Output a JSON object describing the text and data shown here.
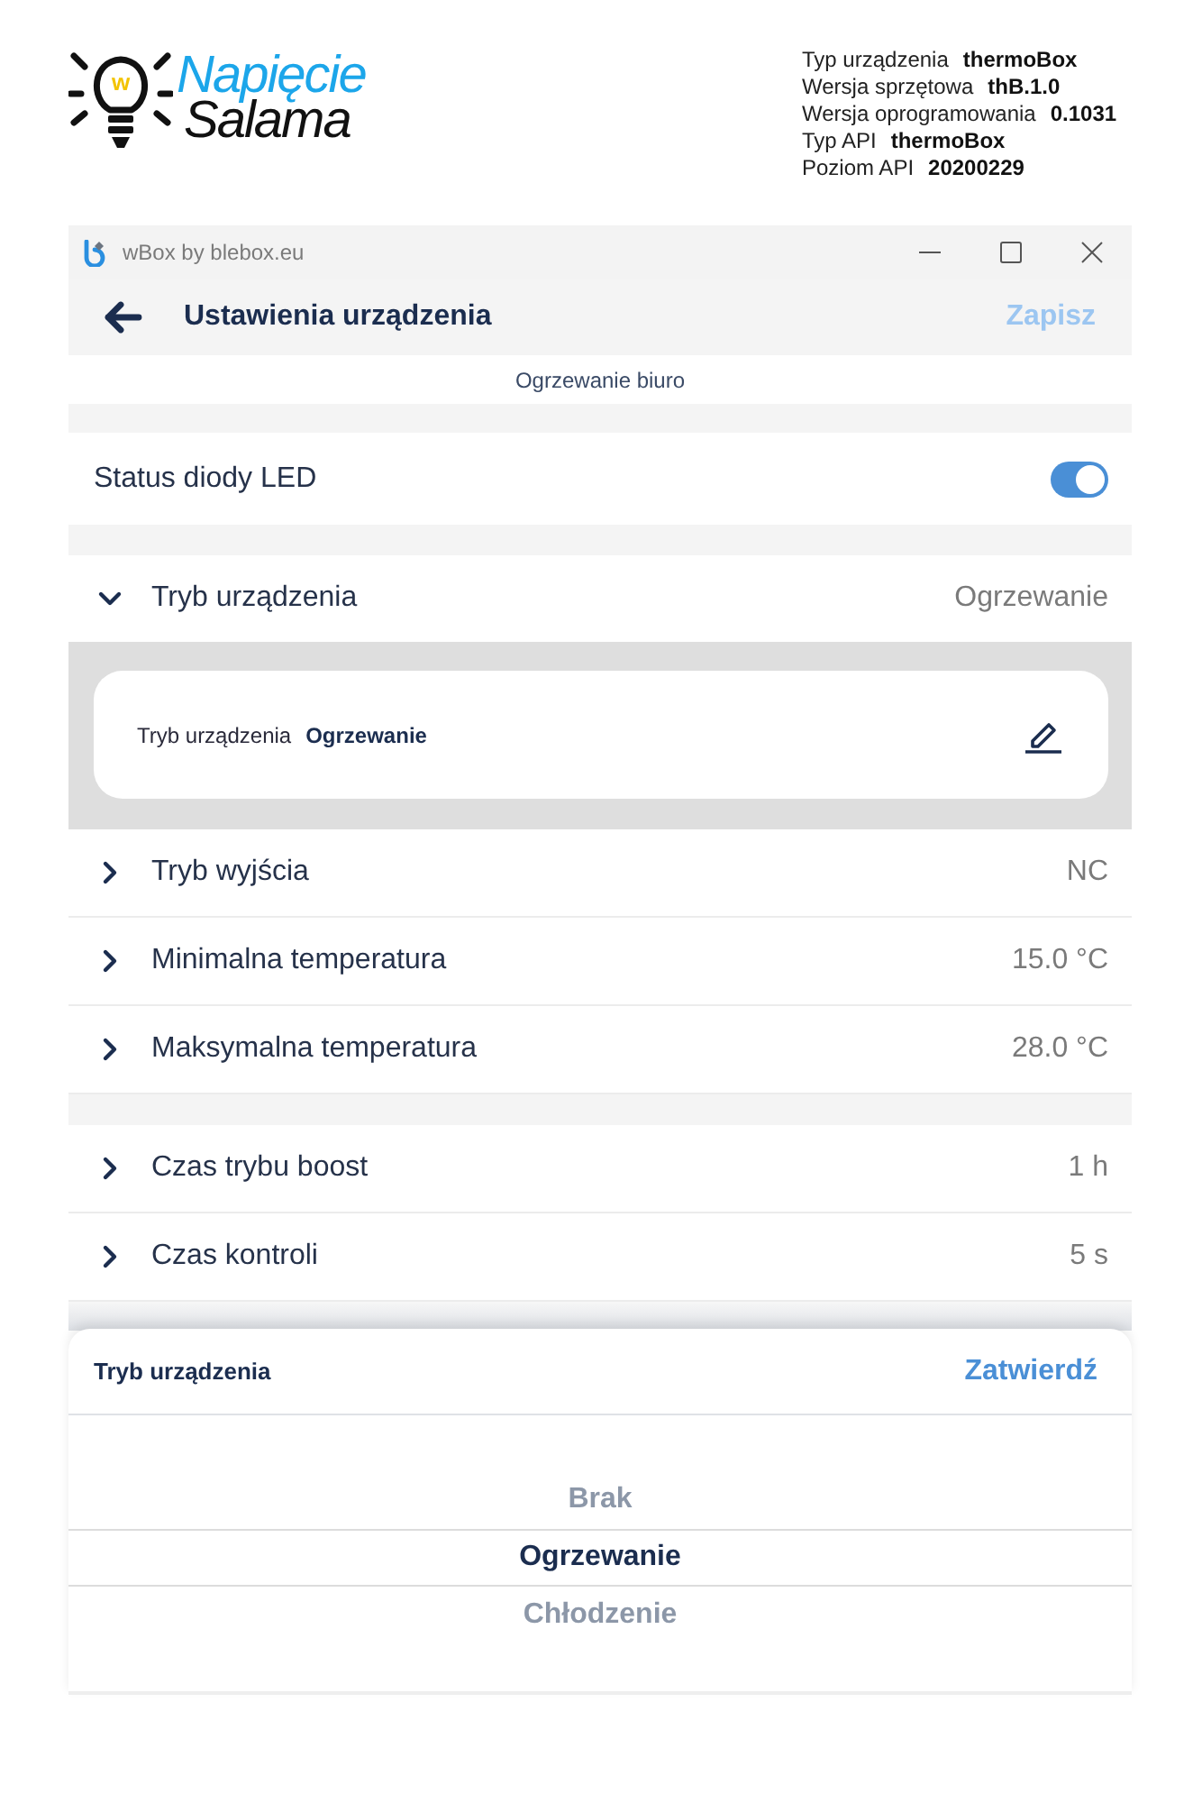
{
  "logo": {
    "mark": "w",
    "line_1": "Napięcie",
    "line_2": "Salama"
  },
  "device_info": [
    {
      "label": "Typ urządzenia",
      "value": "thermoBox"
    },
    {
      "label": "Wersja sprzętowa",
      "value": "thB.1.0"
    },
    {
      "label": "Wersja oprogramowania",
      "value": "0.1031"
    },
    {
      "label": "Typ API",
      "value": "thermoBox"
    },
    {
      "label": "Poziom API",
      "value": "20200229"
    }
  ],
  "window": {
    "title": "wBox by blebox.eu"
  },
  "app_bar": {
    "title": "Ustawienia urządzenia",
    "action": {
      "label": "Zapisz",
      "disabled": true
    }
  },
  "subtitle": "Ogrzewanie biuro",
  "sections": [
    {
      "rows": [
        {
          "kind": "toggle",
          "label": "Status diody LED",
          "on": true
        }
      ]
    },
    {
      "rows": [
        {
          "kind": "expandable",
          "label": "Tryb urządzenia",
          "value": "Ogrzewanie",
          "expanded": true,
          "detail": {
            "label": "Tryb urządzenia",
            "value": "Ogrzewanie"
          }
        },
        {
          "kind": "expandable",
          "label": "Tryb wyjścia",
          "value": "NC",
          "expanded": false
        },
        {
          "kind": "expandable",
          "label": "Minimalna temperatura",
          "value": "15.0 °C",
          "expanded": false
        },
        {
          "kind": "expandable",
          "label": "Maksymalna temperatura",
          "value": "28.0 °C",
          "expanded": false
        }
      ]
    },
    {
      "rows": [
        {
          "kind": "expandable",
          "label": "Czas trybu boost",
          "value": "1 h",
          "expanded": false
        },
        {
          "kind": "expandable",
          "label": "Czas kontroli",
          "value": "5 s",
          "expanded": false
        }
      ]
    }
  ],
  "picker": {
    "title": "Tryb urządzenia",
    "confirm": "Zatwierdź",
    "options": [
      {
        "label": "Brak",
        "selected": false
      },
      {
        "label": "Ogrzewanie",
        "selected": true
      },
      {
        "label": "Chłodzenie",
        "selected": false
      }
    ]
  }
}
